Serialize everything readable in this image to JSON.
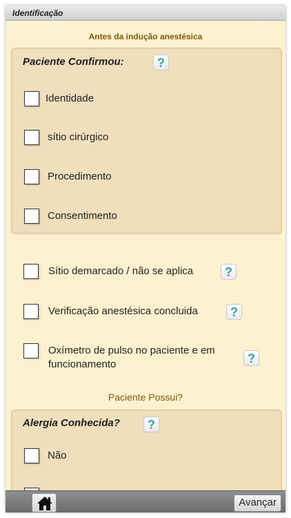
{
  "header": {
    "title": "Identificação"
  },
  "section": {
    "title": "Antes da indução anestésica"
  },
  "panel_confirm": {
    "title": "Paciente Confirmou:",
    "help": "?",
    "items": [
      "Identidade",
      "sítio cirúrgico",
      "Procedimento",
      "Consentimento"
    ]
  },
  "checks": [
    {
      "label": "Sítio demarcado / não se aplica",
      "help": "?"
    },
    {
      "label": "Verificação anestésica concluida",
      "help": "?"
    },
    {
      "label": "Oxímetro de pulso no paciente e em funcionamento",
      "help": "?"
    }
  ],
  "patient_has": {
    "title": "Paciente Possui?"
  },
  "panel_allergy": {
    "title": "Alergia Conhecida?",
    "help": "?",
    "items": [
      "Não",
      ""
    ]
  },
  "footer": {
    "home_icon": "home-icon",
    "next_label": "Avançar"
  }
}
